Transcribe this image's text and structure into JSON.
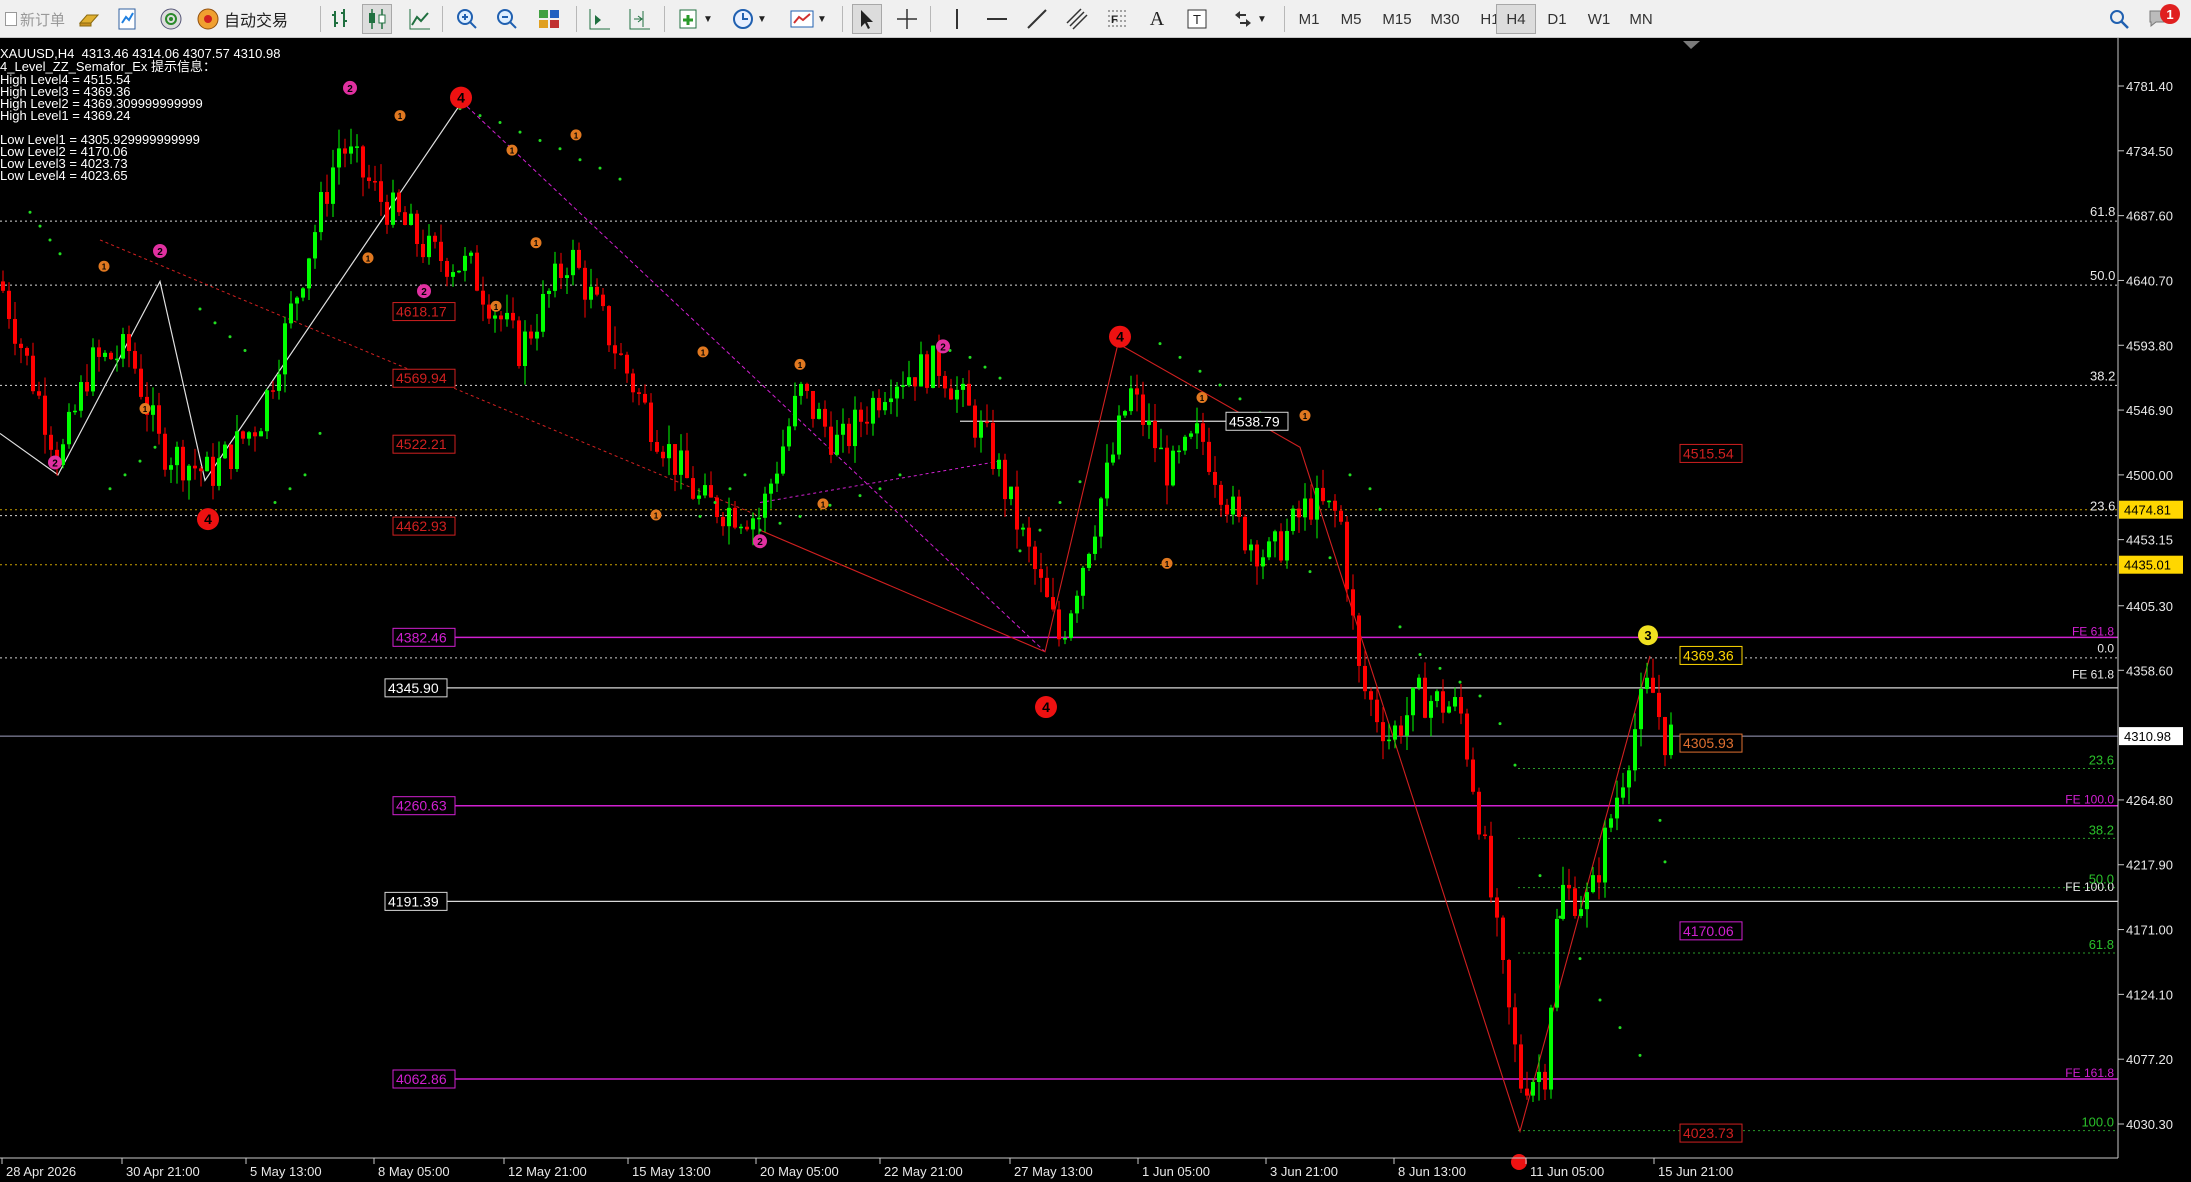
{
  "toolbar": {
    "new_order_label": "新订单",
    "auto_trade_label": "自动交易",
    "timeframes": [
      "M1",
      "M5",
      "M15",
      "M30",
      "H1",
      "H4",
      "D1",
      "W1",
      "MN"
    ],
    "active_timeframe": "H4",
    "notification_count": "1"
  },
  "info_panel": {
    "header": "XAUUSD,H4  4313.46 4314.06 4307.57 4310.98",
    "indicator": "4_Level_ZZ_Semafor_Ex 提示信息：",
    "high_levels": [
      "High Level4 = 4515.54",
      "High Level3 = 4369.36",
      "High Level2 = 4369.309999999999",
      "High Level1 = 4369.24"
    ],
    "low_levels": [
      "Low Level1 = 4305.929999999999",
      "Low Level2 = 4170.06",
      "Low Level3 = 4023.73",
      "Low Level4 = 4023.65"
    ]
  },
  "price_axis": {
    "labels": [
      "4781.40",
      "4734.50",
      "4687.60",
      "4640.70",
      "4593.80",
      "4546.90",
      "4500.00",
      "4453.15",
      "4405.30",
      "4358.60",
      "4264.80",
      "4217.90",
      "4171.00",
      "4124.10",
      "4077.20",
      "4030.30"
    ],
    "current_price": "4310.98",
    "yellow_tags": [
      "4474.81",
      "4435.01"
    ]
  },
  "time_axis": {
    "labels": [
      "28 Apr 2026",
      "30 Apr 21:00",
      "5 May 13:00",
      "8 May 05:00",
      "12 May 21:00",
      "15 May 13:00",
      "20 May 05:00",
      "22 May 21:00",
      "27 May 13:00",
      "1 Jun 05:00",
      "3 Jun 21:00",
      "8 Jun 13:00",
      "11 Jun 05:00",
      "15 Jun 21:00"
    ]
  },
  "fib_levels": {
    "left_labels": [
      "4618.17",
      "4569.94",
      "4522.21",
      "4462.93",
      "4382.46",
      "4260.63",
      "4062.86"
    ],
    "white_boxes": [
      "4345.90",
      "4191.39",
      "4538.79"
    ],
    "right_grid_labels": [
      "61.8",
      "50.0",
      "38.2",
      "23.6"
    ],
    "fe_labels": [
      "FE 61.8",
      "0.0",
      "FE 61.8",
      "FE 100.0",
      "FE 100.0",
      "FE 161.8"
    ],
    "green_labels": [
      "23.6",
      "38.2",
      "50.0",
      "61.8",
      "100.0"
    ],
    "semafor_price_tags": [
      "4515.54",
      "4369.36",
      "4305.93",
      "4170.06",
      "4023.73"
    ]
  },
  "semafor_marks": {
    "level4": [
      "4",
      "4",
      "4",
      "4"
    ],
    "level3": [
      "3"
    ],
    "level2": [
      "2",
      "2",
      "2",
      "2",
      "2",
      "2"
    ],
    "level1": [
      "1",
      "1",
      "1",
      "1",
      "1",
      "1",
      "1",
      "1",
      "1",
      "1",
      "1",
      "1",
      "1",
      "1",
      "1"
    ]
  },
  "colors": {
    "bull": "#00ff00",
    "bear": "#ff0000",
    "fib_magenta": "#d020d0",
    "level_red": "#d02020",
    "tag_yellow": "#ffd700"
  }
}
